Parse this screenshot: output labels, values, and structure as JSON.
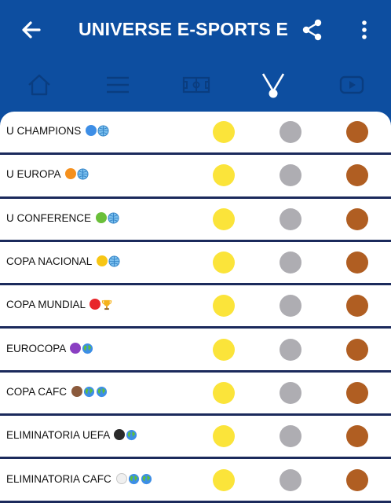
{
  "header": {
    "title": "UNIVERSE E-SPORTS E",
    "back_icon": "arrow-left-icon",
    "share_icon": "share-icon",
    "more_icon": "more-vert-icon"
  },
  "tabs": [
    {
      "name": "home",
      "icon": "home-icon"
    },
    {
      "name": "menu",
      "icon": "list-icon"
    },
    {
      "name": "field",
      "icon": "soccer-field-icon"
    },
    {
      "name": "medals",
      "icon": "medal-icon",
      "active": true
    },
    {
      "name": "video",
      "icon": "play-icon"
    }
  ],
  "colors": {
    "primary": "#0d4ea0",
    "divider": "#1b2a5c",
    "gold": "#fbe43a",
    "silver": "#aeadb2",
    "bronze": "#b05e22"
  },
  "rows": [
    {
      "label": "U CHAMPIONS",
      "badges": [
        {
          "type": "circle",
          "color": "#3d8ee6"
        },
        {
          "type": "globe"
        }
      ]
    },
    {
      "label": "U EUROPA",
      "badges": [
        {
          "type": "circle",
          "color": "#f5901d"
        },
        {
          "type": "globe"
        }
      ]
    },
    {
      "label": "U CONFERENCE",
      "badges": [
        {
          "type": "circle",
          "color": "#6abf3a"
        },
        {
          "type": "globe"
        }
      ]
    },
    {
      "label": "COPA NACIONAL",
      "badges": [
        {
          "type": "circle",
          "color": "#f7c615"
        },
        {
          "type": "globe"
        }
      ]
    },
    {
      "label": "COPA MUNDIAL",
      "badges": [
        {
          "type": "circle",
          "color": "#e8262b"
        },
        {
          "type": "trophy"
        }
      ]
    },
    {
      "label": "EUROCOPA",
      "badges": [
        {
          "type": "circle",
          "color": "#8a3fc2"
        },
        {
          "type": "earth"
        }
      ]
    },
    {
      "label": "COPA CAFC",
      "badges": [
        {
          "type": "circle",
          "color": "#8b5a3c"
        },
        {
          "type": "earth"
        },
        {
          "type": "earth"
        }
      ]
    },
    {
      "label": "ELIMINATORIA UEFA",
      "badges": [
        {
          "type": "circle",
          "color": "#2a2a2a"
        },
        {
          "type": "earth"
        }
      ]
    },
    {
      "label": "ELIMINATORIA CAFC",
      "badges": [
        {
          "type": "circle",
          "color": "#f0f0f0"
        },
        {
          "type": "earth"
        },
        {
          "type": "earth"
        }
      ]
    }
  ]
}
